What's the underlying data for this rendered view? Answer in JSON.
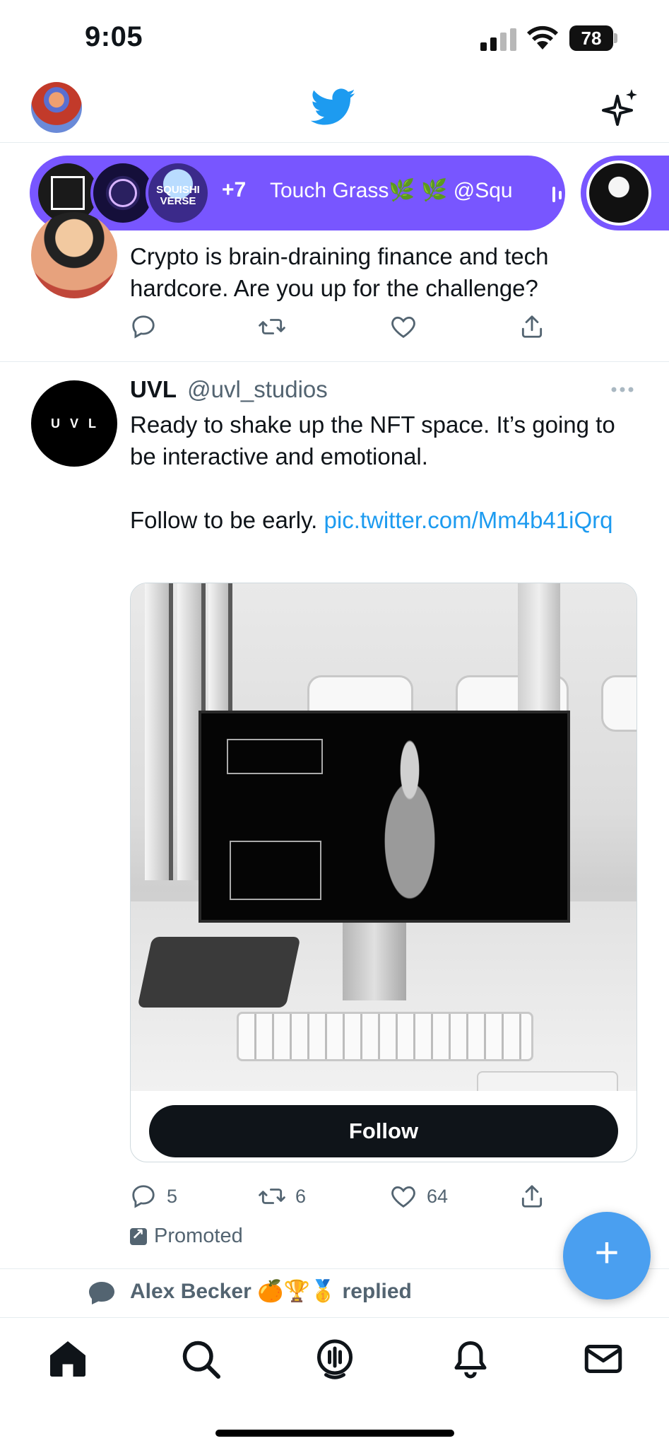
{
  "status_bar": {
    "time": "9:05",
    "battery": "78"
  },
  "top_nav": {
    "logo": "twitter-bird-icon",
    "right_icon": "sparkle-icon"
  },
  "spaces": {
    "extra_count": "+7",
    "title": "Touch Grass🌿 🌿 @Squ",
    "avatar3_label": "SQUISHI VERSE"
  },
  "prev_tweet": {
    "text": "Crypto is brain-draining finance and tech hardcore. Are you up for the challenge?"
  },
  "tweet": {
    "avatar_text": "UVL",
    "name": "UVL",
    "handle": "@uvl_studios",
    "body_line1": "Ready to shake up the NFT space. It’s going to be interactive and emotional.",
    "body_line2": "Follow to be early.",
    "link": "pic.twitter.com/Mm4b41iQrq",
    "follow_label": "Follow",
    "replies": "5",
    "retweets": "6",
    "likes": "64",
    "promoted_label": "Promoted"
  },
  "next": {
    "replied_text": "Alex Becker 🍊🏆🥇 replied"
  },
  "fab": {
    "label": "+"
  },
  "colors": {
    "accent": "#1d9bf0",
    "spaces_purple": "#7856ff",
    "text_primary": "#0f1419",
    "text_secondary": "#536471"
  }
}
